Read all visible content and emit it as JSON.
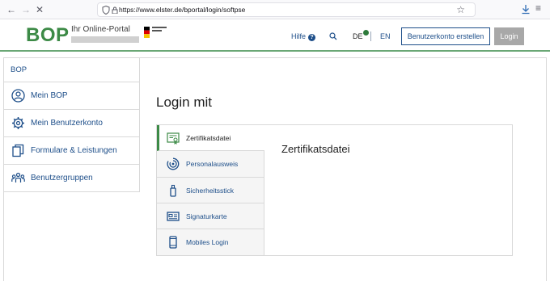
{
  "browser": {
    "url_prefix": "https://www.",
    "url_host": "elster.de",
    "url_path": "/bportal/login/softpse"
  },
  "header": {
    "logo": "BOP",
    "subtitle": "Ihr Online-Portal",
    "help_label": "Hilfe",
    "help_badge": "?",
    "lang_de": "DE",
    "lang_en": "EN",
    "register_label": "Benutzerkonto erstellen",
    "login_label": "Login"
  },
  "sidebar": {
    "title": "BOP",
    "items": [
      {
        "label": "Mein BOP",
        "icon": "person-circle-icon"
      },
      {
        "label": "Mein Benutzerkonto",
        "icon": "gear-icon"
      },
      {
        "label": "Formulare & Leistungen",
        "icon": "documents-icon"
      },
      {
        "label": "Benutzergruppen",
        "icon": "group-icon"
      }
    ]
  },
  "main": {
    "title": "Login mit",
    "content_title": "Zertifikatsdatei",
    "tabs": [
      {
        "label": "Zertifikatsdatei",
        "icon": "certificate-icon",
        "active": true
      },
      {
        "label": "Personalausweis",
        "icon": "id-card-icon",
        "active": false
      },
      {
        "label": "Sicherheitsstick",
        "icon": "usb-stick-icon",
        "active": false
      },
      {
        "label": "Signaturkarte",
        "icon": "signature-card-icon",
        "active": false
      },
      {
        "label": "Mobiles Login",
        "icon": "mobile-phone-icon",
        "active": false
      }
    ]
  },
  "colors": {
    "brand_green": "#3c8a46",
    "link_blue": "#1d4e89"
  }
}
